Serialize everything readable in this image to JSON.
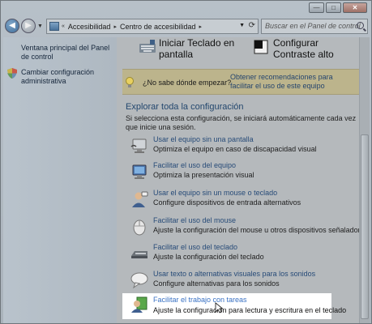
{
  "window": {
    "buttons": {
      "minimize": "—",
      "maximize": "□",
      "close": "✕"
    }
  },
  "nav": {
    "back_glyph": "◀",
    "forward_glyph": "▶",
    "breadcrumbs": [
      "Accesibilidad",
      "Centro de accesibilidad"
    ],
    "crumb_sep": "▸",
    "leading_sep": "«",
    "search_placeholder": "Buscar en el Panel de control"
  },
  "sidebar": {
    "items": [
      {
        "label": "Ventana principal del Panel de control"
      },
      {
        "label": "Cambiar configuración administrativa"
      }
    ]
  },
  "top_tiles": [
    {
      "label": "Iniciar Teclado en pantalla"
    },
    {
      "label": "Configurar Contraste alto"
    }
  ],
  "tip": {
    "question": "¿No sabe dónde empezar?",
    "link": "Obtener recomendaciones para facilitar el uso de este equipo"
  },
  "section": {
    "title": "Explorar toda la configuración",
    "description": "Si selecciona esta configuración, se iniciará automáticamente cada vez que inicie una sesión."
  },
  "items": [
    {
      "title": "Usar el equipo sin una pantalla",
      "desc": "Optimiza el equipo en caso de discapacidad visual",
      "icon": "monitor-icon"
    },
    {
      "title": "Facilitar el uso del equipo",
      "desc": "Optimiza la presentación visual",
      "icon": "display-icon"
    },
    {
      "title": "Usar el equipo sin un mouse o teclado",
      "desc": "Configure dispositivos de entrada alternativos",
      "icon": "user-speech-icon"
    },
    {
      "title": "Facilitar el uso del mouse",
      "desc": "Ajuste la configuración del mouse u otros dispositivos señaladores",
      "icon": "mouse-icon"
    },
    {
      "title": "Facilitar el uso del teclado",
      "desc": "Ajuste la configuración del teclado",
      "icon": "keyboard-icon"
    },
    {
      "title": "Usar texto o alternativas visuales para los sonidos",
      "desc": "Configure alternativas para los sonidos",
      "icon": "speech-bubble-icon"
    },
    {
      "title": "Facilitar el trabajo con tareas",
      "desc": "Ajuste la configuración para lectura y escritura en el teclado",
      "icon": "user-tasks-icon"
    }
  ]
}
